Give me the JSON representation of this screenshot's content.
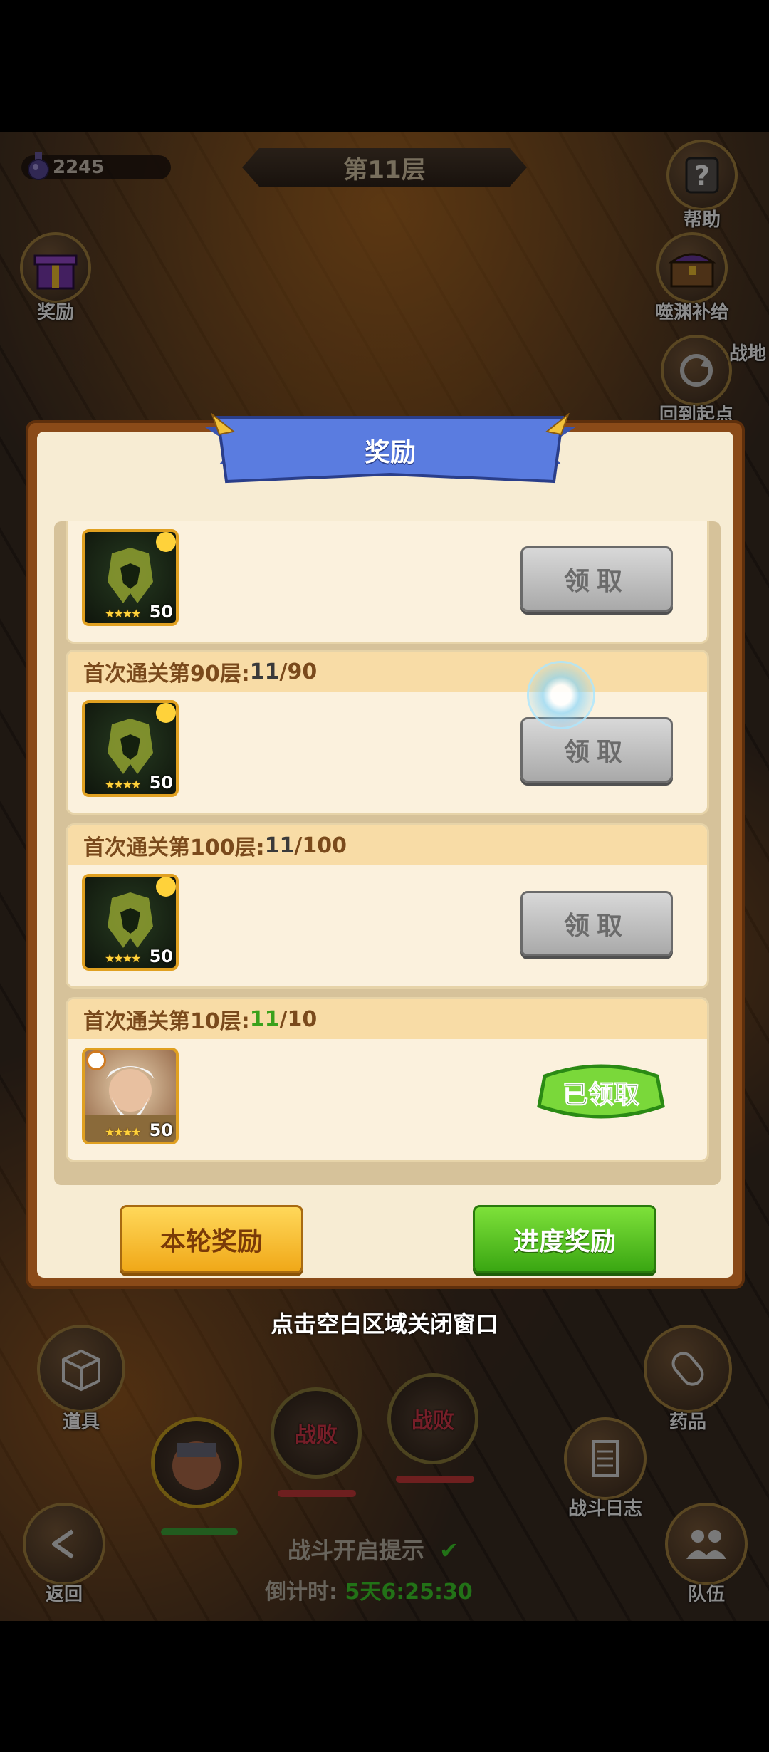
{
  "hud": {
    "currency": "2245",
    "floor_title": "第11层",
    "help_label": "帮助",
    "reward_label": "奖励",
    "supply_label": "噬渊补给",
    "return_start_label": "回到起点",
    "map_label": "战地"
  },
  "dialog": {
    "title": "奖励",
    "cards": [
      {
        "header_prefix": "",
        "current": "",
        "sep_total": "",
        "level": "50",
        "stars": "★★★★",
        "button": "领取",
        "claimed": false
      },
      {
        "header_prefix": "首次通关第90层:",
        "current": "11",
        "sep_total": "/90",
        "level": "50",
        "stars": "★★★★",
        "button": "领取",
        "claimed": false
      },
      {
        "header_prefix": "首次通关第100层:",
        "current": "11",
        "sep_total": "/100",
        "level": "50",
        "stars": "★★★★",
        "button": "领取",
        "claimed": false
      },
      {
        "header_prefix": "首次通关第10层:",
        "current": "11",
        "sep_total": "/10",
        "level": "50",
        "stars": "★★★★",
        "button": "",
        "claimed": true,
        "claimed_label": "已领取"
      }
    ],
    "btn_round": "本轮奖励",
    "btn_progress": "进度奖励",
    "close_hint": "点击空白区域关闭窗口"
  },
  "bottom": {
    "items_label": "道具",
    "potion_label": "药品",
    "battle_log_label": "战斗日志",
    "back_label": "返回",
    "team_label": "队伍",
    "defeat_1": "战败",
    "defeat_2": "战败",
    "battle_hint": "战斗开启提示",
    "countdown_label": "倒计时:",
    "countdown_value": "5天6:25:30"
  },
  "colors": {
    "dialog_border": "#8a4a18",
    "dialog_bg": "#f7ecd3",
    "ribbon_blue": "#4a6bd0",
    "btn_yellow": "#f0a818",
    "btn_green": "#3aa612",
    "progress_done": "#3aa11c"
  }
}
